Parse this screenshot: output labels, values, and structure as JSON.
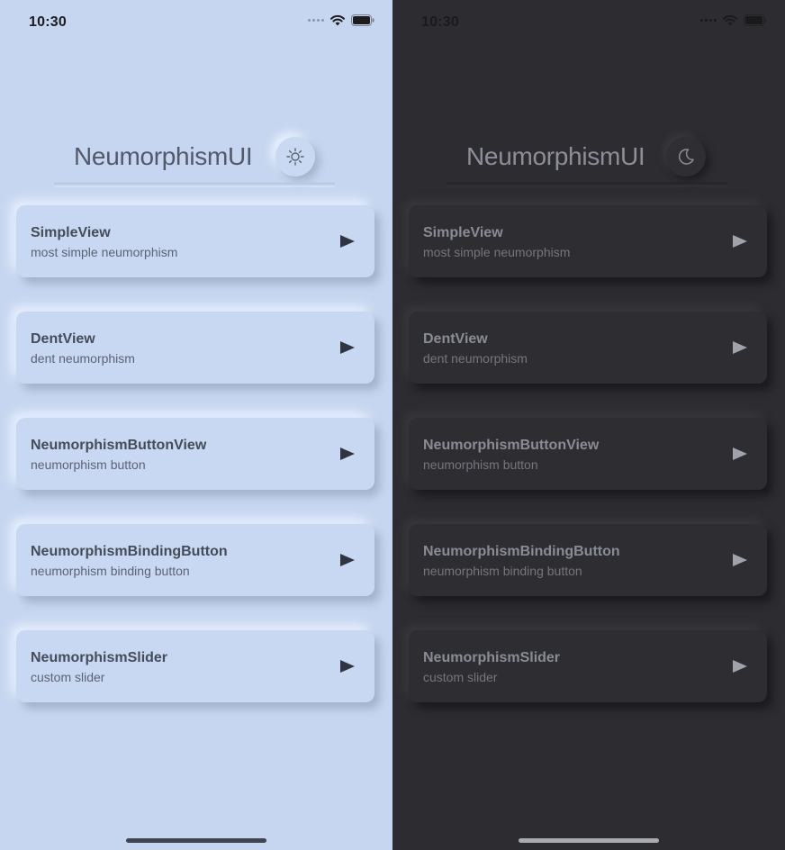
{
  "status_bar": {
    "time": "10:30"
  },
  "header": {
    "title": "NeumorphismUI",
    "light_toggle_icon": "sun-icon",
    "dark_toggle_icon": "moon-icon"
  },
  "items": [
    {
      "title": "SimpleView",
      "subtitle": "most simple neumorphism"
    },
    {
      "title": "DentView",
      "subtitle": "dent neumorphism"
    },
    {
      "title": "NeumorphismButtonView",
      "subtitle": "neumorphism button"
    },
    {
      "title": "NeumorphismBindingButton",
      "subtitle": "neumorphism binding button"
    },
    {
      "title": "NeumorphismSlider",
      "subtitle": "custom slider"
    }
  ],
  "colors": {
    "light_background": "#c6d6f0",
    "dark_background": "#2d2d31",
    "light_text": "#454c59",
    "dark_text": "#8a8c95"
  }
}
